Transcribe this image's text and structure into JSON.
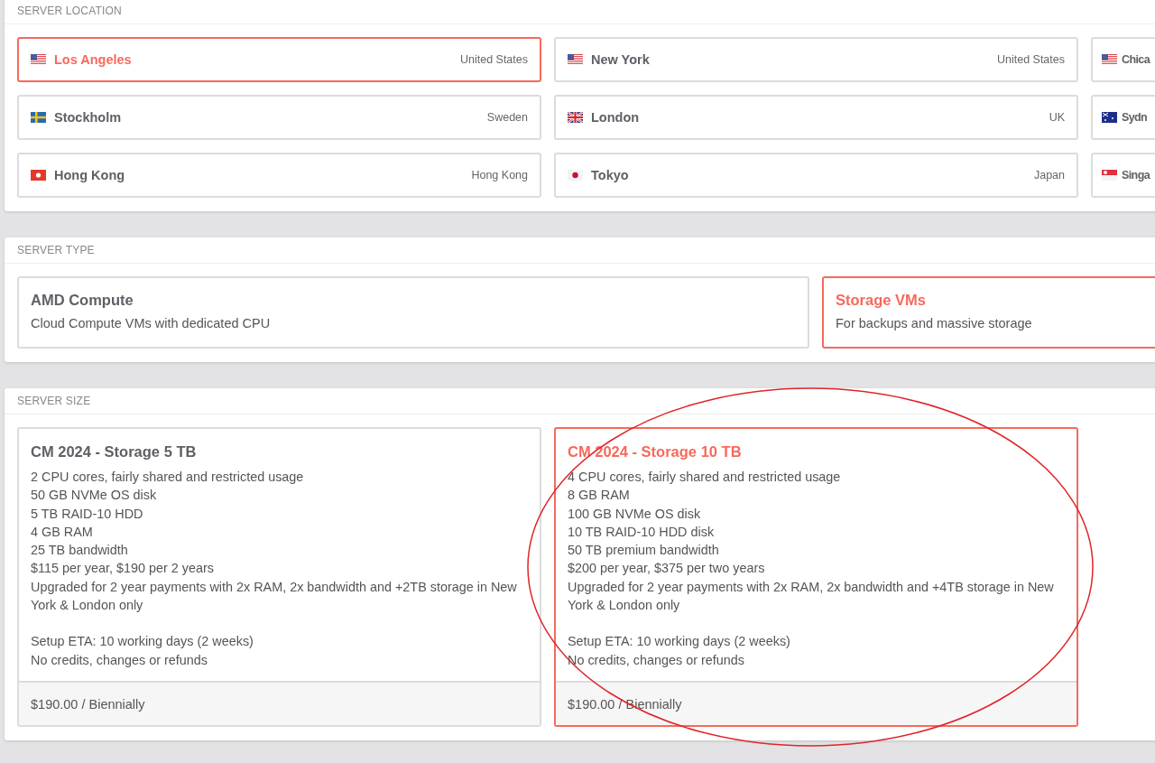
{
  "server_location": {
    "heading": "SERVER LOCATION",
    "locations": [
      {
        "city": "Los Angeles",
        "country": "United States",
        "kind": "us",
        "selected": true
      },
      {
        "city": "New York",
        "country": "United States",
        "kind": "us",
        "selected": false
      },
      {
        "city": "Chica",
        "kind": "us",
        "selected": false
      },
      {
        "city": "Stockholm",
        "country": "Sweden",
        "kind": "se",
        "selected": false
      },
      {
        "city": "London",
        "country": "UK",
        "kind": "gb",
        "selected": false
      },
      {
        "city": "Sydn",
        "kind": "au",
        "selected": false
      },
      {
        "city": "Hong Kong",
        "country": "Hong Kong",
        "kind": "hk",
        "selected": false
      },
      {
        "city": "Tokyo",
        "country": "Japan",
        "kind": "jp",
        "selected": false
      },
      {
        "city": "Singa",
        "kind": "sg",
        "selected": false
      }
    ]
  },
  "server_type": {
    "heading": "SERVER TYPE",
    "options": [
      {
        "title": "AMD Compute",
        "description": "Cloud Compute VMs with dedicated CPU",
        "selected": false
      },
      {
        "title": "Storage VMs",
        "description": "For backups and massive storage",
        "selected": true
      }
    ]
  },
  "server_size": {
    "heading": "SERVER SIZE",
    "plans": [
      {
        "title": "CM 2024 - Storage 5 TB",
        "features": [
          "2 CPU cores, fairly shared and restricted usage",
          "50 GB NVMe OS disk",
          "5 TB RAID-10 HDD",
          "4 GB RAM",
          "25 TB bandwidth",
          "$115 per year, $190 per 2 years",
          "Upgraded for 2 year payments with 2x RAM, 2x bandwidth and +2TB storage in New York & London only"
        ],
        "terms": [
          "Setup ETA: 10 working days (2 weeks)",
          "No credits, changes or refunds"
        ],
        "price": "$190.00 / Biennially",
        "selected": false
      },
      {
        "title": "CM 2024 - Storage 10 TB",
        "features": [
          "4 CPU cores, fairly shared and restricted usage",
          "8 GB RAM",
          "100 GB NVMe OS disk",
          "10 TB RAID-10 HDD disk",
          "50 TB premium bandwidth",
          "$200 per year, $375 per two years",
          "Upgraded for 2 year payments with 2x RAM, 2x bandwidth and +4TB storage in New York & London only"
        ],
        "terms": [
          "Setup ETA: 10 working days (2 weeks)",
          "No credits, changes or refunds"
        ],
        "price": "$190.00 / Biennially",
        "selected": true
      }
    ]
  }
}
